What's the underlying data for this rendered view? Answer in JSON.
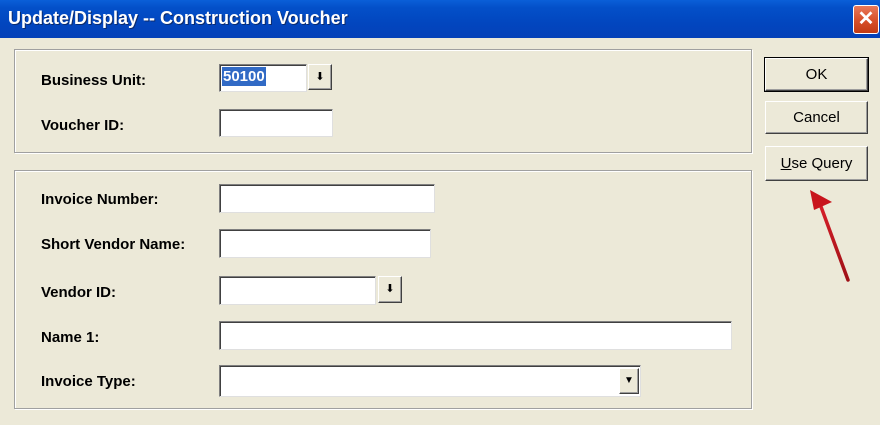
{
  "window": {
    "title": "Update/Display -- Construction Voucher",
    "close_glyph": "✕"
  },
  "top_group": {
    "business_unit": {
      "label": "Business Unit:",
      "value": "50100"
    },
    "voucher_id": {
      "label": "Voucher ID:",
      "value": ""
    }
  },
  "bottom_group": {
    "invoice_number": {
      "label": "Invoice Number:",
      "value": ""
    },
    "short_vendor_name": {
      "label": "Short Vendor Name:",
      "value": ""
    },
    "vendor_id": {
      "label": "Vendor ID:",
      "value": ""
    },
    "name1": {
      "label": "Name 1:",
      "value": ""
    },
    "invoice_type": {
      "label": "Invoice Type:",
      "value": ""
    }
  },
  "buttons": {
    "ok": "OK",
    "cancel": "Cancel",
    "use_query_mnemonic": "U",
    "use_query_rest": "se Query"
  },
  "icons": {
    "dropdown_arrow": "⬇",
    "combo_arrow": "▼"
  },
  "colors": {
    "title_bar": "#0246bf",
    "dialog_bg": "#ece9d8",
    "selection": "#316ac5",
    "arrow": "#c8141c"
  }
}
